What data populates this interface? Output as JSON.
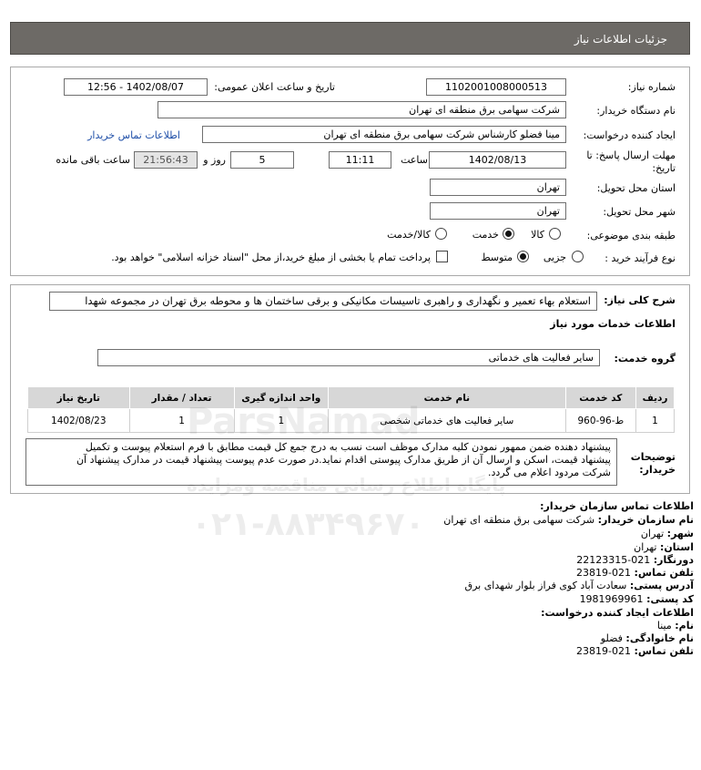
{
  "header": {
    "title": "جزئیات اطلاعات نیاز"
  },
  "form": {
    "need_number_label": "شماره نیاز:",
    "need_number": "1102001008000513",
    "announce_label": "تاریخ و ساعت اعلان عمومی:",
    "announce_value": "1402/08/07 - 12:56",
    "buyer_org_label": "نام دستگاه خریدار:",
    "buyer_org": "شرکت سهامی برق منطقه ای تهران",
    "creator_label": "ایجاد کننده درخواست:",
    "creator": "مینا فضلو کارشناس شرکت سهامی برق منطقه ای تهران",
    "contact_link": "اطلاعات تماس خریدار",
    "deadline_label_1": "مهلت ارسال پاسخ: تا",
    "deadline_label_2": "تاریخ:",
    "deadline_date": "1402/08/13",
    "time_label": "ساعت",
    "deadline_time": "11:11",
    "days": "5",
    "days_label": "روز و",
    "remaining": "21:56:43",
    "remaining_label": "ساعت باقی مانده",
    "province_label": "استان محل تحویل:",
    "province": "تهران",
    "city_label": "شهر محل تحویل:",
    "city": "تهران",
    "category_label": "طبقه بندی موضوعی:",
    "cat_goods": "کالا",
    "cat_service": "خدمت",
    "cat_both": "کالا/خدمت",
    "process_label": "نوع فرآیند خرید :",
    "proc_partial": "جزیی",
    "proc_medium": "متوسط",
    "treasury_note": "پرداخت تمام یا بخشی از مبلغ خرید،از محل \"اسناد خزانه اسلامی\" خواهد بود."
  },
  "summary": {
    "label": "شرح کلی نیاز:",
    "text": "استعلام بهاء تعمیر و نگهداری و راهبری تاسیسات مکانیکی و برقی ساختمان ها و محوطه برق تهران در مجموعه شهدا",
    "services_title": "اطلاعات خدمات مورد نیاز",
    "group_label": "گروه خدمت:",
    "group_value": "سایر فعالیت های خدماتی"
  },
  "table": {
    "headers": [
      "ردیف",
      "کد خدمت",
      "نام خدمت",
      "واحد اندازه گیری",
      "تعداد / مقدار",
      "تاریخ نیاز"
    ],
    "rows": [
      [
        "1",
        "ط-96-960",
        "سایر فعالیت های خدماتی شخصی",
        "1",
        "1",
        "1402/08/23"
      ]
    ]
  },
  "buyer_notes": {
    "label_1": "توضیحات",
    "label_2": "خریدار:",
    "lines": [
      "پیشنهاد دهنده ضمن ممهور نمودن کلیه مدارک موظف است نسب به درج جمع کل قیمت مطابق با فرم استعلام پیوست و تکمیل",
      "پیشنهاد قیمت، اسکن و ارسال آن از طریق مدارک پیوستی اقدام نماید.در صورت عدم پیوست پیشنهاد قیمت در مدارک پیشنهاد آن",
      "شرکت مردود اعلام می گردد."
    ]
  },
  "contact": {
    "title": "اطلاعات تماس سازمان خریدار:",
    "org_label": "نام سازمان خریدار:",
    "org": "شرکت سهامی برق منطقه ای تهران",
    "city_label": "شهر:",
    "city": "تهران",
    "province_label": "استان:",
    "province": "تهران",
    "fax_label": "دورنگار:",
    "fax": "021-22123315",
    "phone_label": "تلفن تماس:",
    "phone": "021-23819",
    "address_label": "آدرس پستی:",
    "address": "سعادت آباد کوی فراز بلوار شهدای برق",
    "postal_label": "کد پستی:",
    "postal": "1981969961",
    "creator_title": "اطلاعات ایجاد کننده درخواست:",
    "name_label": "نام:",
    "name": "مینا",
    "family_label": "نام خانوادگی:",
    "family": "فضلو",
    "creator_phone_label": "تلفن تماس:",
    "creator_phone": "021-23819"
  },
  "watermark": {
    "brand": "ParsNamad",
    "line1": "پایگاه اطلاع رسانی مناقصه ومزایده",
    "phone": "۰۲۱-۸۸۳۴۹۶۷۰"
  }
}
